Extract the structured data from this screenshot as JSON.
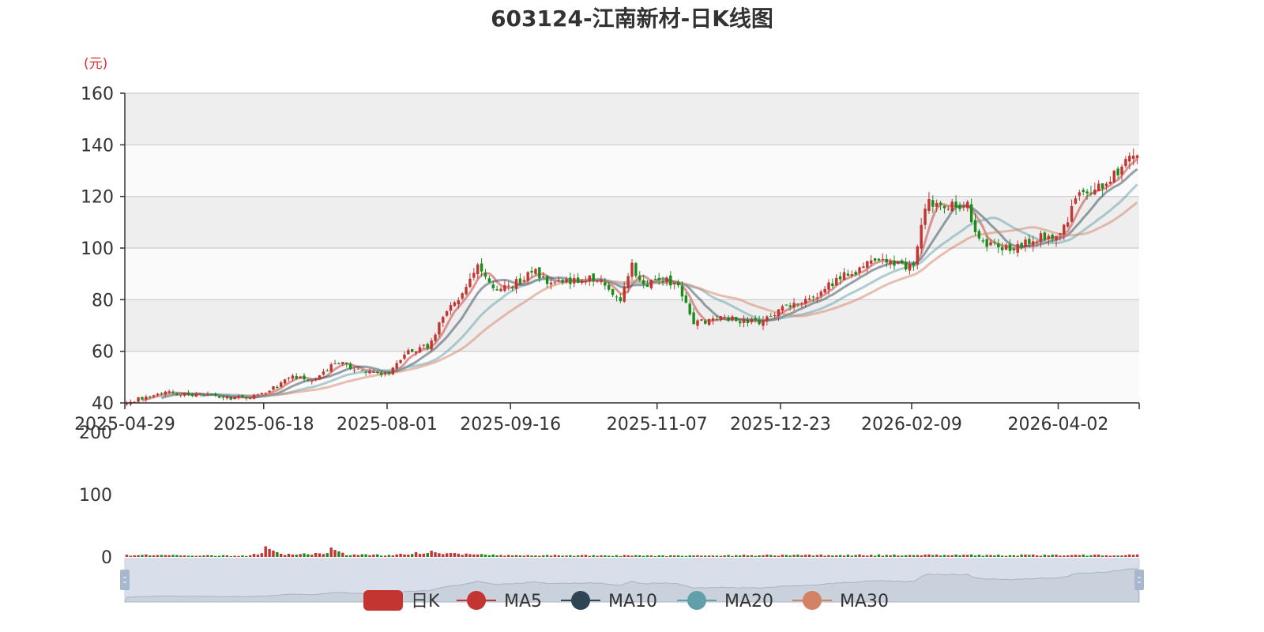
{
  "chart_data": {
    "type": "candlestick",
    "title": "603124-江南新材-日K线图",
    "y_unit": "(元)",
    "x_tick_labels": [
      "2025-04-29",
      "2025-06-18",
      "2025-08-01",
      "2025-09-16",
      "2025-11-07",
      "2025-12-23",
      "2026-02-09",
      "2026-04-02"
    ],
    "price_axis": {
      "min": 40,
      "max": 160,
      "ticks": [
        "40",
        "60",
        "80",
        "100",
        "120",
        "140",
        "160"
      ]
    },
    "volume_axis": {
      "min": 0,
      "max": 200,
      "ticks": [
        "0",
        "100",
        "200"
      ]
    },
    "grid": true,
    "legend_position": "bottom",
    "colors": {
      "up": "#c23531",
      "down": "#1a8c1a",
      "ma5": "#c23531",
      "ma10": "#2f4554",
      "ma20": "#61a0a8",
      "ma30": "#d48265",
      "grid_band_dark": "#eeeeee",
      "grid_band_light": "#fafafa",
      "slider_fill": "#d8dfea",
      "slider_handle": "#a7b7cc"
    },
    "series": [
      {
        "name": "日K",
        "kind": "candlestick"
      },
      {
        "name": "MA5",
        "kind": "line",
        "window": 5
      },
      {
        "name": "MA10",
        "kind": "line",
        "window": 10
      },
      {
        "name": "MA20",
        "kind": "line",
        "window": 20
      },
      {
        "name": "MA30",
        "kind": "line",
        "window": 30
      }
    ],
    "close_anchors": [
      [
        "2025-04-29",
        40
      ],
      [
        "2025-05-09",
        44
      ],
      [
        "2025-05-20",
        43.5
      ],
      [
        "2025-06-05",
        42
      ],
      [
        "2025-06-11",
        42
      ],
      [
        "2025-06-18",
        44
      ],
      [
        "2025-06-27",
        50
      ],
      [
        "2025-07-07",
        49
      ],
      [
        "2025-07-14",
        56
      ],
      [
        "2025-07-22",
        53
      ],
      [
        "2025-08-01",
        51
      ],
      [
        "2025-08-08",
        60
      ],
      [
        "2025-08-15",
        62
      ],
      [
        "2025-08-22",
        76
      ],
      [
        "2025-08-28",
        82
      ],
      [
        "2025-09-03",
        94
      ],
      [
        "2025-09-09",
        83
      ],
      [
        "2025-09-16",
        86
      ],
      [
        "2025-09-24",
        91
      ],
      [
        "2025-09-30",
        86
      ],
      [
        "2025-10-16",
        89
      ],
      [
        "2025-10-24",
        79
      ],
      [
        "2025-10-29",
        93
      ],
      [
        "2025-11-03",
        85
      ],
      [
        "2025-11-07",
        88
      ],
      [
        "2025-11-14",
        86
      ],
      [
        "2025-11-20",
        71
      ],
      [
        "2025-12-01",
        73
      ],
      [
        "2025-12-15",
        71
      ],
      [
        "2025-12-23",
        77
      ],
      [
        "2026-01-05",
        82
      ],
      [
        "2026-01-12",
        88
      ],
      [
        "2026-01-20",
        92
      ],
      [
        "2026-01-28",
        96
      ],
      [
        "2026-02-05",
        92
      ],
      [
        "2026-02-09",
        94
      ],
      [
        "2026-02-12",
        117
      ],
      [
        "2026-02-27",
        116
      ],
      [
        "2026-03-04",
        103
      ],
      [
        "2026-03-16",
        99
      ],
      [
        "2026-03-25",
        104
      ],
      [
        "2026-04-02",
        106
      ],
      [
        "2026-04-09",
        120
      ],
      [
        "2026-04-16",
        124
      ],
      [
        "2026-04-24",
        131
      ],
      [
        "2026-04-30",
        137
      ]
    ],
    "volume_anchors": [
      [
        "2025-04-29",
        3
      ],
      [
        "2025-06-11",
        2
      ],
      [
        "2025-06-18",
        6
      ],
      [
        "2025-06-27",
        4
      ],
      [
        "2025-07-11",
        5
      ],
      [
        "2025-08-01",
        3
      ],
      [
        "2025-08-15",
        7
      ],
      [
        "2025-08-28",
        4
      ],
      [
        "2025-09-16",
        3
      ],
      [
        "2025-11-07",
        2
      ],
      [
        "2025-12-23",
        3
      ],
      [
        "2026-02-09",
        3
      ],
      [
        "2026-04-02",
        3
      ],
      [
        "2026-04-30",
        3
      ]
    ],
    "volume_spikes": [
      [
        "2025-06-18",
        17
      ],
      [
        "2025-07-11",
        15
      ],
      [
        "2025-08-18",
        10
      ]
    ]
  }
}
